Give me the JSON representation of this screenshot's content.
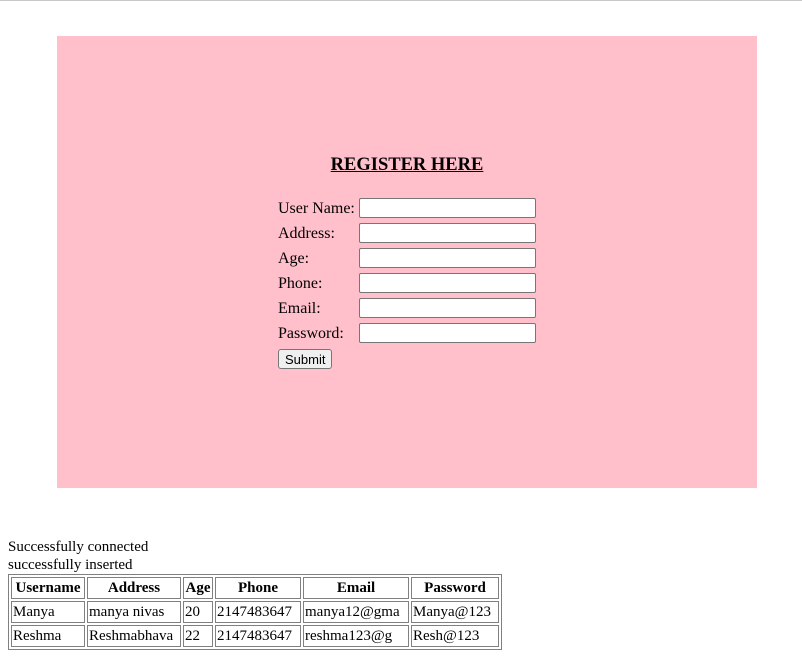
{
  "form": {
    "title": "REGISTER HERE",
    "fields": [
      {
        "label": "User Name:",
        "value": ""
      },
      {
        "label": "Address:",
        "value": ""
      },
      {
        "label": "Age:",
        "value": ""
      },
      {
        "label": "Phone:",
        "value": ""
      },
      {
        "label": "Email:",
        "value": ""
      },
      {
        "label": "Password:",
        "value": ""
      }
    ],
    "submit_label": "Submit",
    "background_color": "#ffc0cb"
  },
  "status": {
    "line1": "Successfully connected",
    "line2": "successfully inserted"
  },
  "table": {
    "headers": [
      "Username",
      "Address",
      "Age",
      "Phone",
      "Email",
      "Password"
    ],
    "rows": [
      [
        "Manya",
        "manya nivas",
        "20",
        "2147483647",
        "manya12@gma",
        "Manya@123"
      ],
      [
        "Reshma",
        "Reshmabhava",
        "22",
        "2147483647",
        "reshma123@g",
        "Resh@123"
      ]
    ]
  }
}
